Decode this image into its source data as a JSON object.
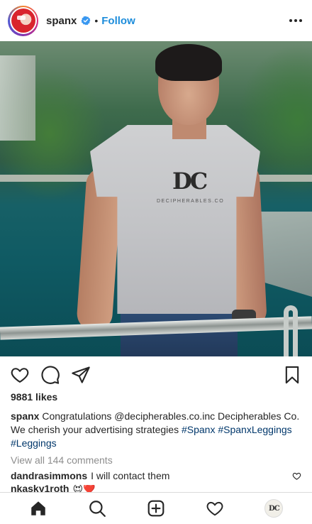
{
  "header": {
    "username": "spanx",
    "separator": "•",
    "follow_label": "Follow",
    "verified_icon": "verified-badge-icon",
    "more_icon": "more-options-icon"
  },
  "post": {
    "photo_alt_brand": "DC",
    "shirt_text": "DECIPHERABLES.CO"
  },
  "actions": {
    "icons": [
      "heart-icon",
      "comment-icon",
      "share-icon",
      "bookmark-icon"
    ]
  },
  "likes_text": "9881 likes",
  "caption": {
    "username": "spanx",
    "text": "Congratulations @decipherables.co.inc Decipherables Co. We cherish your advertising strategies",
    "tags": [
      "#Spanx",
      "#SpanxLeggings",
      "#Leggings"
    ]
  },
  "view_all_comments": "View all 144 comments",
  "comments": [
    {
      "username": "dandrasimmons",
      "text": "I will contact them"
    },
    {
      "username": "nkasky1roth",
      "text": "😍❤️"
    }
  ],
  "bottom_nav": {
    "icons": [
      "home-icon",
      "search-icon",
      "new-post-icon",
      "activity-icon",
      "profile-avatar"
    ],
    "profile_mark": "DC"
  },
  "colors": {
    "link_blue": "#1d8ddb",
    "hashtag_blue": "#00376b",
    "muted_gray": "#8e8e8e",
    "text": "#262626"
  }
}
